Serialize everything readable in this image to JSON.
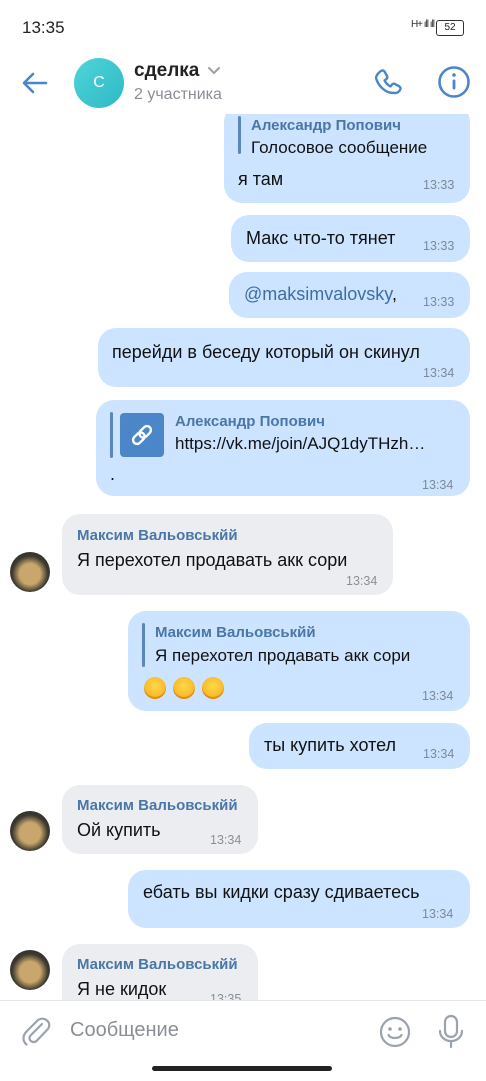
{
  "status_bar": {
    "time": "13:35",
    "signal": "H+ ıll ıll",
    "battery": "52"
  },
  "header": {
    "avatar_letter": "С",
    "title": "сделка",
    "subtitle": "2 участника"
  },
  "messages": [
    {
      "reply_name": "Александр Попович",
      "reply_text": "Голосовое сообщение",
      "text": "я там",
      "time": "13:33"
    },
    {
      "text": "Макс что-то тянет",
      "time": "13:33"
    },
    {
      "mention": "@maksimvalovsky",
      "text": ",",
      "time": "13:33"
    },
    {
      "text": "перейди в беседу который он скинул",
      "time": "13:34"
    },
    {
      "reply_name": "Александр Попович",
      "reply_text": "https://vk.me/join/AJQ1dyTHzh…",
      "text": ".",
      "time": "13:34"
    },
    {
      "sender": "Максим Вальовськйй",
      "text": "Я перехотел продавать акк сори",
      "time": "13:34"
    },
    {
      "reply_name": "Максим Вальовськйй",
      "reply_text": "Я перехотел продавать акк сори",
      "time": "13:34"
    },
    {
      "text": "ты купить хотел",
      "time": "13:34"
    },
    {
      "sender": "Максим Вальовськйй",
      "text": "Ой купить",
      "time": "13:34"
    },
    {
      "text": "ебать вы кидки сразу сдиваетесь",
      "time": "13:34"
    },
    {
      "sender": "Максим Вальовськйй",
      "text": "Я не кидок",
      "time": "13:35"
    }
  ],
  "composer": {
    "placeholder": "Сообщение"
  },
  "icons": [
    "back-arrow-icon",
    "phone-icon",
    "info-icon",
    "chevron-down-icon",
    "link-icon",
    "laughing-emoji-icon",
    "paperclip-icon",
    "smile-icon",
    "microphone-icon"
  ],
  "colors": {
    "accent": "#4a76a8",
    "outgoing": "#cce4ff",
    "incoming": "#ebedf0",
    "avatar": "#3ec7cf"
  }
}
